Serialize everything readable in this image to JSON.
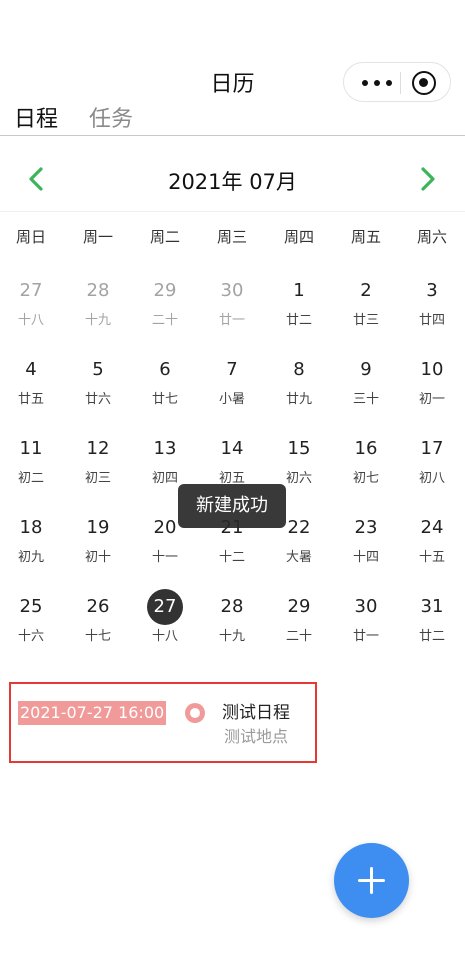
{
  "navbar": {
    "title": "日历",
    "more_icon": "more-dots-icon",
    "close_icon": "target-circle-icon"
  },
  "tabs": [
    {
      "label": "日程",
      "active": true
    },
    {
      "label": "任务",
      "active": false
    }
  ],
  "calendar": {
    "month_title": "2021年 07月",
    "prev_icon": "chevron-left-icon",
    "next_icon": "chevron-right-icon",
    "accent_color": "#3cb55a",
    "weekdays": [
      "周日",
      "周一",
      "周二",
      "周三",
      "周四",
      "周五",
      "周六"
    ],
    "weeks": [
      [
        {
          "day": "27",
          "lunar": "十八",
          "other": true
        },
        {
          "day": "28",
          "lunar": "十九",
          "other": true
        },
        {
          "day": "29",
          "lunar": "二十",
          "other": true
        },
        {
          "day": "30",
          "lunar": "廿一",
          "other": true
        },
        {
          "day": "1",
          "lunar": "廿二"
        },
        {
          "day": "2",
          "lunar": "廿三"
        },
        {
          "day": "3",
          "lunar": "廿四"
        }
      ],
      [
        {
          "day": "4",
          "lunar": "廿五"
        },
        {
          "day": "5",
          "lunar": "廿六"
        },
        {
          "day": "6",
          "lunar": "廿七"
        },
        {
          "day": "7",
          "lunar": "小暑"
        },
        {
          "day": "8",
          "lunar": "廿九"
        },
        {
          "day": "9",
          "lunar": "三十"
        },
        {
          "day": "10",
          "lunar": "初一"
        }
      ],
      [
        {
          "day": "11",
          "lunar": "初二"
        },
        {
          "day": "12",
          "lunar": "初三"
        },
        {
          "day": "13",
          "lunar": "初四"
        },
        {
          "day": "14",
          "lunar": "初五"
        },
        {
          "day": "15",
          "lunar": "初六"
        },
        {
          "day": "16",
          "lunar": "初七"
        },
        {
          "day": "17",
          "lunar": "初八"
        }
      ],
      [
        {
          "day": "18",
          "lunar": "初九"
        },
        {
          "day": "19",
          "lunar": "初十"
        },
        {
          "day": "20",
          "lunar": "十一"
        },
        {
          "day": "21",
          "lunar": "十二"
        },
        {
          "day": "22",
          "lunar": "大暑"
        },
        {
          "day": "23",
          "lunar": "十四"
        },
        {
          "day": "24",
          "lunar": "十五"
        }
      ],
      [
        {
          "day": "25",
          "lunar": "十六"
        },
        {
          "day": "26",
          "lunar": "十七"
        },
        {
          "day": "27",
          "lunar": "十八",
          "today": true
        },
        {
          "day": "28",
          "lunar": "十九"
        },
        {
          "day": "29",
          "lunar": "二十"
        },
        {
          "day": "30",
          "lunar": "廿一"
        },
        {
          "day": "31",
          "lunar": "廿二"
        }
      ]
    ]
  },
  "toast": {
    "message": "新建成功"
  },
  "event": {
    "time": "2021-07-27 16:00",
    "title": "测试日程",
    "location": "测试地点",
    "highlight_color": "#f19a9a",
    "border_color": "#e53935"
  },
  "fab": {
    "icon": "plus-icon",
    "color": "#3d8ef0"
  }
}
